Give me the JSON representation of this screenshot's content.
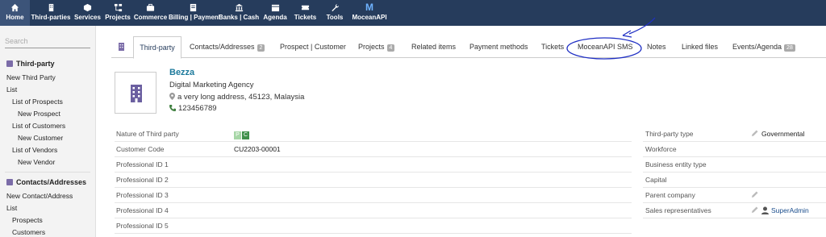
{
  "topmenu": [
    {
      "label": "Home",
      "icon": "home-icon"
    },
    {
      "label": "Third-parties",
      "icon": "building-icon"
    },
    {
      "label": "Services",
      "icon": "cube-icon"
    },
    {
      "label": "Projects",
      "icon": "sitemap-icon"
    },
    {
      "label": "Commerce",
      "icon": "briefcase-icon"
    },
    {
      "label": "Billing | Payment",
      "icon": "invoice-icon"
    },
    {
      "label": "Banks | Cash",
      "icon": "bank-icon"
    },
    {
      "label": "Agenda",
      "icon": "calendar-icon"
    },
    {
      "label": "Tickets",
      "icon": "ticket-icon"
    },
    {
      "label": "Tools",
      "icon": "wrench-icon"
    },
    {
      "label": "MoceanAPI",
      "icon": "mocean-logo-icon",
      "logo_text": "M"
    }
  ],
  "sidebar": {
    "search_placeholder": "Search",
    "section1": {
      "title": "Third-party",
      "items": [
        "New Third Party",
        "List",
        "List of Prospects",
        "New Prospect",
        "List of Customers",
        "New Customer",
        "List of Vendors",
        "New Vendor"
      ]
    },
    "section2": {
      "title": "Contacts/Addresses",
      "items": [
        "New Contact/Address",
        "List",
        "Prospects",
        "Customers"
      ]
    }
  },
  "tabs": [
    {
      "label": "Third-party"
    },
    {
      "label": "Contacts/Addresses",
      "badge": "2"
    },
    {
      "label": "Prospect | Customer"
    },
    {
      "label": "Projects",
      "badge": "4"
    },
    {
      "label": "Related items"
    },
    {
      "label": "Payment methods"
    },
    {
      "label": "Tickets"
    },
    {
      "label": "MoceanAPI SMS"
    },
    {
      "label": "Notes"
    },
    {
      "label": "Linked files"
    },
    {
      "label": "Events/Agenda",
      "badge": "28"
    }
  ],
  "thirdparty": {
    "name": "Bezza",
    "type_text": "Digital Marketing Agency",
    "address": "a very long address, 45123, Malaysia",
    "phone": "123456789"
  },
  "left_fields": [
    {
      "label": "Nature of Third party",
      "tags": [
        "P",
        "C"
      ]
    },
    {
      "label": "Customer Code",
      "value": "CU2203-00001"
    },
    {
      "label": "Professional ID 1",
      "value": ""
    },
    {
      "label": "Professional ID 2",
      "value": ""
    },
    {
      "label": "Professional ID 3",
      "value": ""
    },
    {
      "label": "Professional ID 4",
      "value": ""
    },
    {
      "label": "Professional ID 5",
      "value": ""
    }
  ],
  "right_fields": [
    {
      "label": "Third-party type",
      "value": "Governmental",
      "editable": true
    },
    {
      "label": "Workforce",
      "value": ""
    },
    {
      "label": "Business entity type",
      "value": ""
    },
    {
      "label": "Capital",
      "value": ""
    },
    {
      "label": "Parent company",
      "value": "",
      "editable": true
    },
    {
      "label": "Sales representatives",
      "value": "SuperAdmin",
      "editable": true
    }
  ],
  "colors": {
    "topbar": "#263c5c",
    "tag_prospect": "#a6d6a6",
    "tag_customer": "#3f8f4a",
    "name_link": "#1d7a9c",
    "annotation": "#1f2fc4"
  }
}
